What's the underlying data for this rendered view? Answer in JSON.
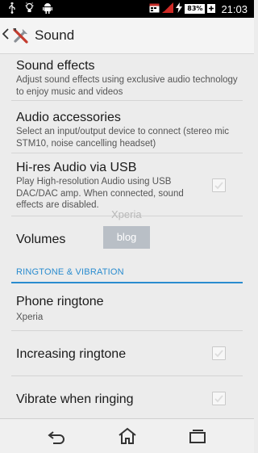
{
  "status_bar": {
    "icons_left": [
      "usb-icon",
      "lightbulb-icon",
      "android-icon"
    ],
    "icons_right": [
      "calendar-notification-icon",
      "signal-icon",
      "charging-icon"
    ],
    "battery_percent": "83%",
    "time": "21:03"
  },
  "action_bar": {
    "title": "Sound",
    "back_icon": "chevron-left-icon",
    "app_icon": "settings-tools-icon"
  },
  "settings": {
    "sound_effects": {
      "title": "Sound effects",
      "summary": "Adjust sound effects using exclusive audio technology to enjoy music and videos"
    },
    "audio_accessories": {
      "title": "Audio accessories",
      "summary": "Select an input/output device to connect (stereo mic STM10, noise cancelling headset)"
    },
    "hires_audio": {
      "title": "Hi-res Audio via USB",
      "summary": "Play High-resolution Audio using USB DAC/DAC amp. When connected, sound effects are disabled.",
      "checked": false
    },
    "volumes": {
      "title": "Volumes"
    },
    "section_ringtone": "RINGTONE & VIBRATION",
    "phone_ringtone": {
      "title": "Phone ringtone",
      "summary": "Xperia"
    },
    "increasing_ringtone": {
      "title": "Increasing ringtone",
      "checked": false
    },
    "vibrate_when_ringing": {
      "title": "Vibrate when ringing",
      "checked": false
    }
  },
  "watermark": {
    "line1": "Xperia",
    "line2": "blog"
  },
  "nav_bar": {
    "icons": [
      "back-icon",
      "home-icon",
      "recent-apps-icon"
    ]
  },
  "colors": {
    "accent": "#2a8ccf",
    "background": "#ececec",
    "status_bar": "#000000"
  }
}
